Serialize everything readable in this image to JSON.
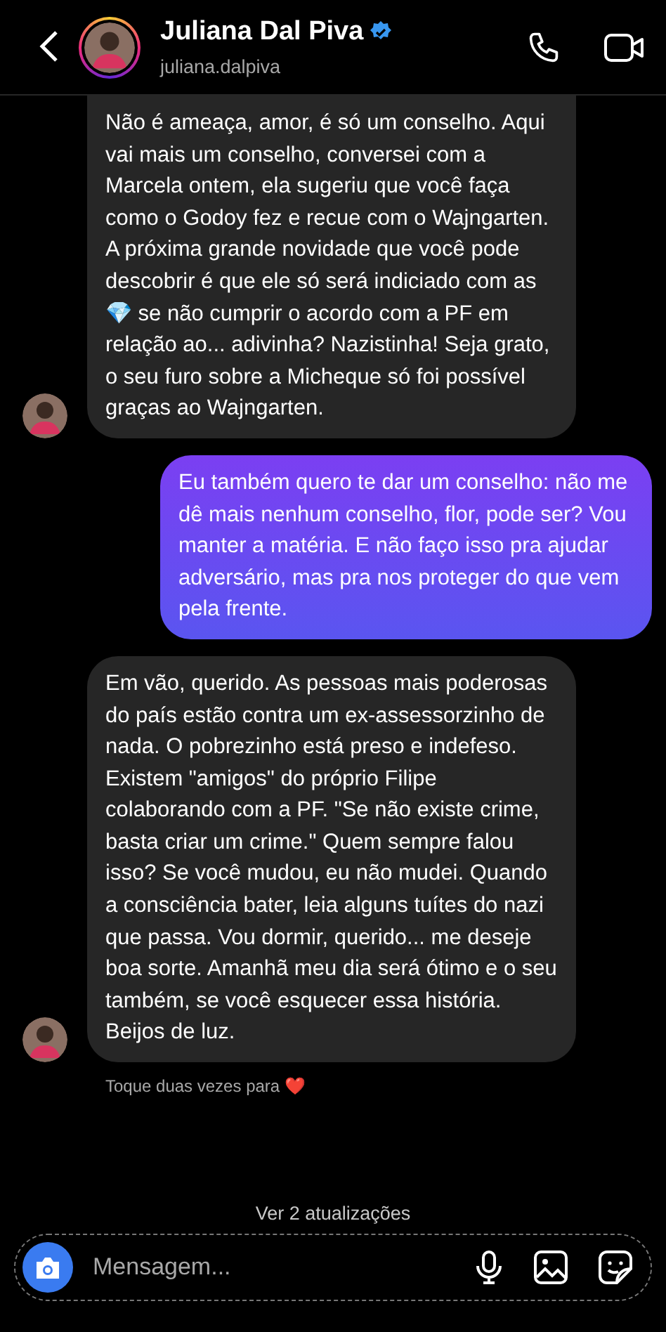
{
  "header": {
    "name": "Juliana Dal Piva",
    "username": "juliana.dalpiva",
    "verified": true,
    "story_ring": true
  },
  "messages": [
    {
      "kind": "received",
      "text": "Não é ameaça, amor, é só um conselho. Aqui vai mais um conselho, conversei com a Marcela ontem, ela sugeriu que você faça como o Godoy fez e recue com o Wajngarten. A próxima grande novidade que você pode descobrir é que ele só será indiciado com as 💎 se não cumprir o acordo com a PF em relação ao... adivinha? Nazistinha! Seja grato, o seu furo sobre a Micheque só foi possível graças ao Wajngarten."
    },
    {
      "kind": "sent",
      "text": "Eu também quero te dar um conselho: não me dê mais nenhum conselho, flor, pode ser? Vou manter a matéria. E não faço isso pra ajudar adversário, mas pra nos proteger do que vem pela frente."
    },
    {
      "kind": "received",
      "text": "Em vão, querido. As pessoas mais poderosas do país estão contra um ex-assessorzinho de nada. O pobrezinho está preso e indefeso. Existem \"amigos\" do próprio Filipe colaborando com a PF. \"Se não existe crime, basta criar um crime.\" Quem sempre falou isso? Se você mudou, eu não mudei. Quando a consciência bater, leia alguns tuítes do nazi que passa. Vou dormir, querido... me deseje boa sorte. Amanhã meu dia será ótimo e o seu também, se você esquecer essa história. Beijos de luz."
    }
  ],
  "hint": "Toque duas vezes para ❤️",
  "updates_link": "Ver 2 atualizações",
  "composer": {
    "placeholder": "Mensagem..."
  }
}
